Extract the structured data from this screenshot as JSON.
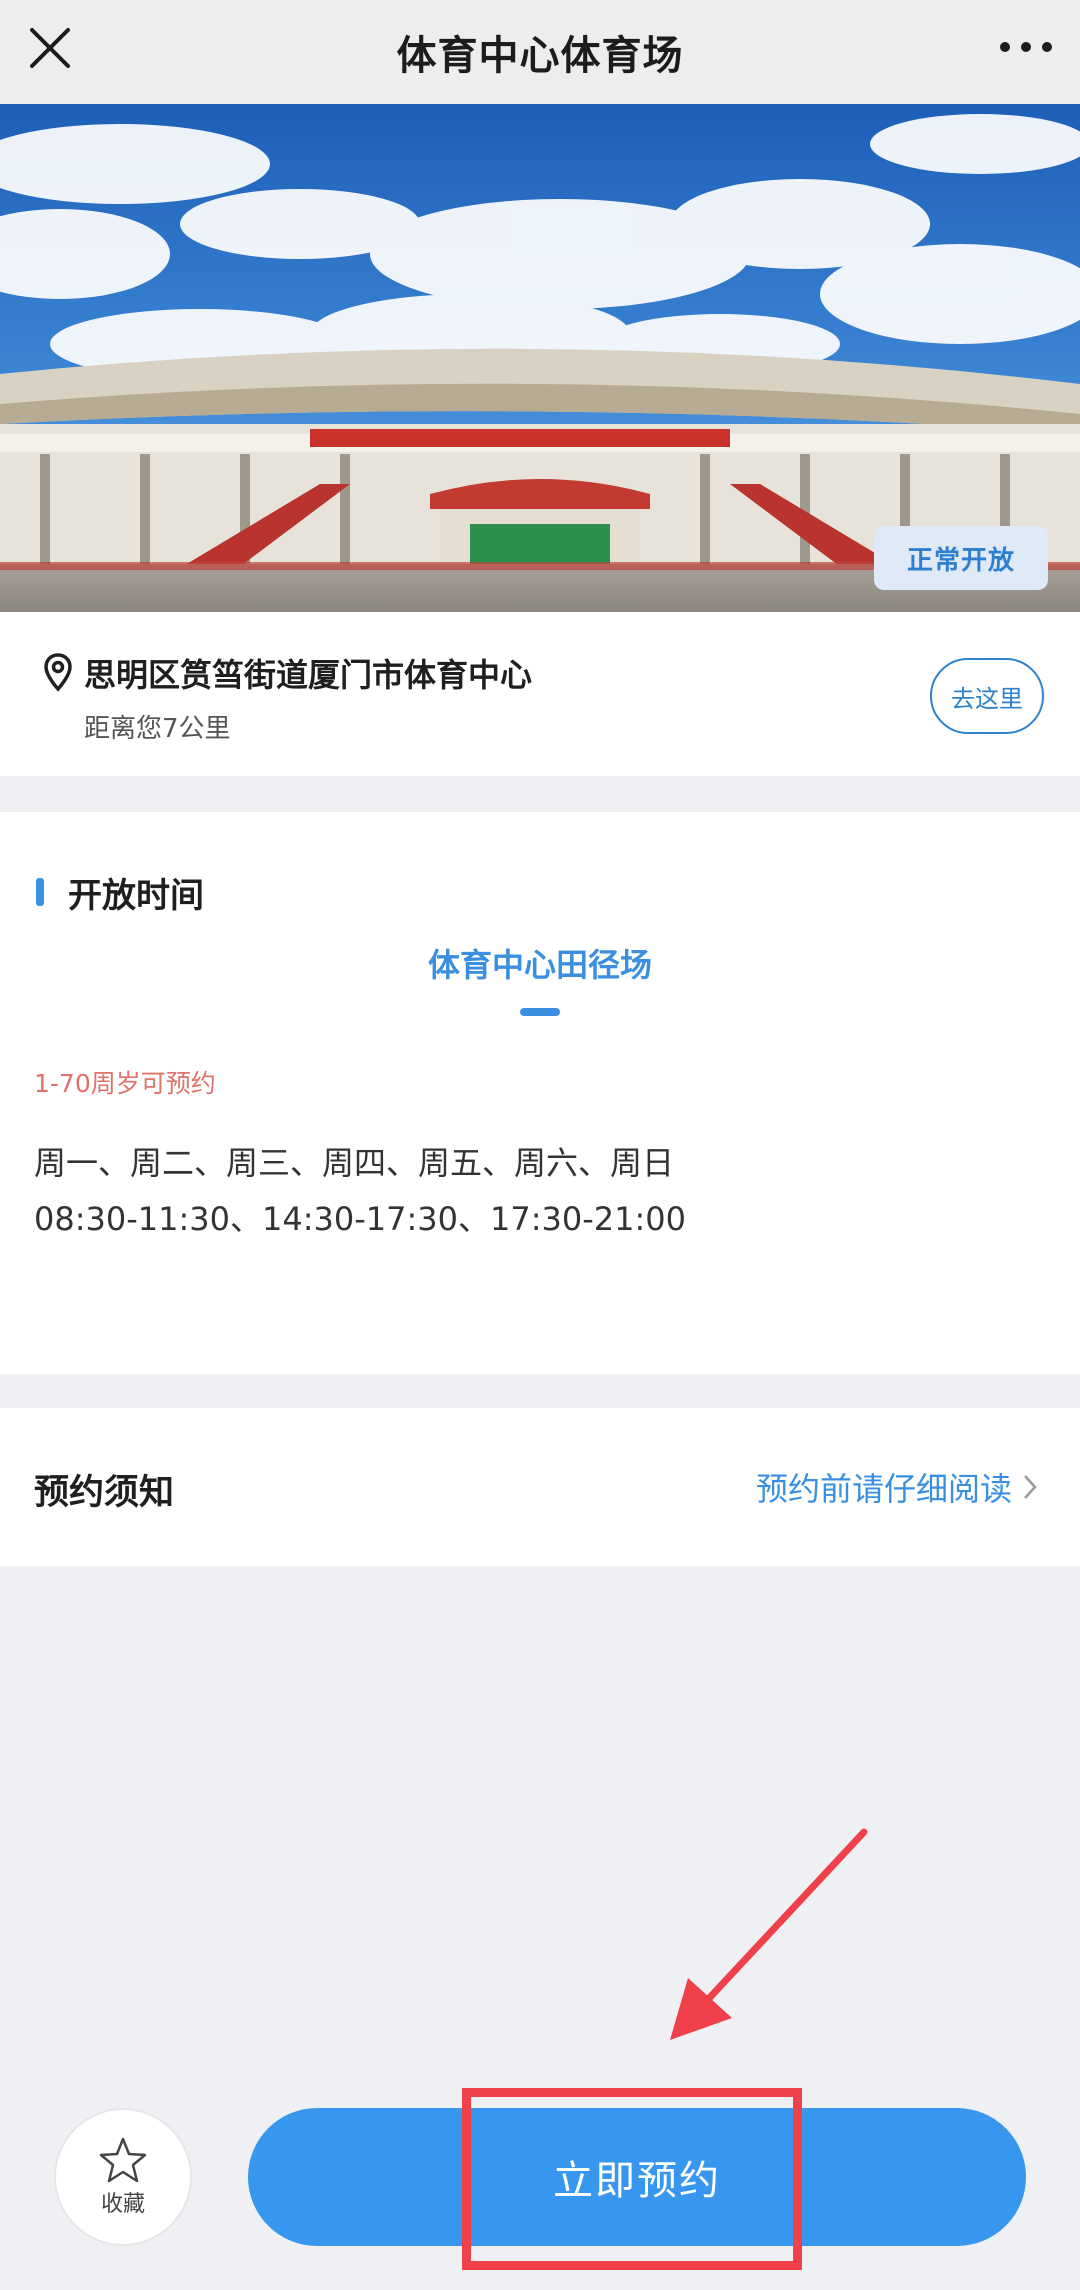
{
  "header": {
    "title": "体育中心体育场",
    "close_icon": "close-icon",
    "more_icon": "more-icon"
  },
  "hero": {
    "status": "正常开放"
  },
  "location": {
    "address": "思明区筼筜街道厦门市体育中心",
    "distance": "距离您7公里",
    "goto_label": "去这里"
  },
  "hours": {
    "section_title": "开放时间",
    "tab_label": "体育中心田径场",
    "age_rule": "1-70周岁可预约",
    "days": "周一、周二、周三、周四、周五、周六、周日",
    "times": "08:30-11:30、14:30-17:30、17:30-21:00"
  },
  "notice": {
    "label": "预约须知",
    "link": "预约前请仔细阅读"
  },
  "bottom": {
    "fav_label": "收藏",
    "book_label": "立即预约"
  },
  "colors": {
    "accent": "#3797ee",
    "highlight": "#f0404a",
    "age_text": "#e0716b"
  }
}
